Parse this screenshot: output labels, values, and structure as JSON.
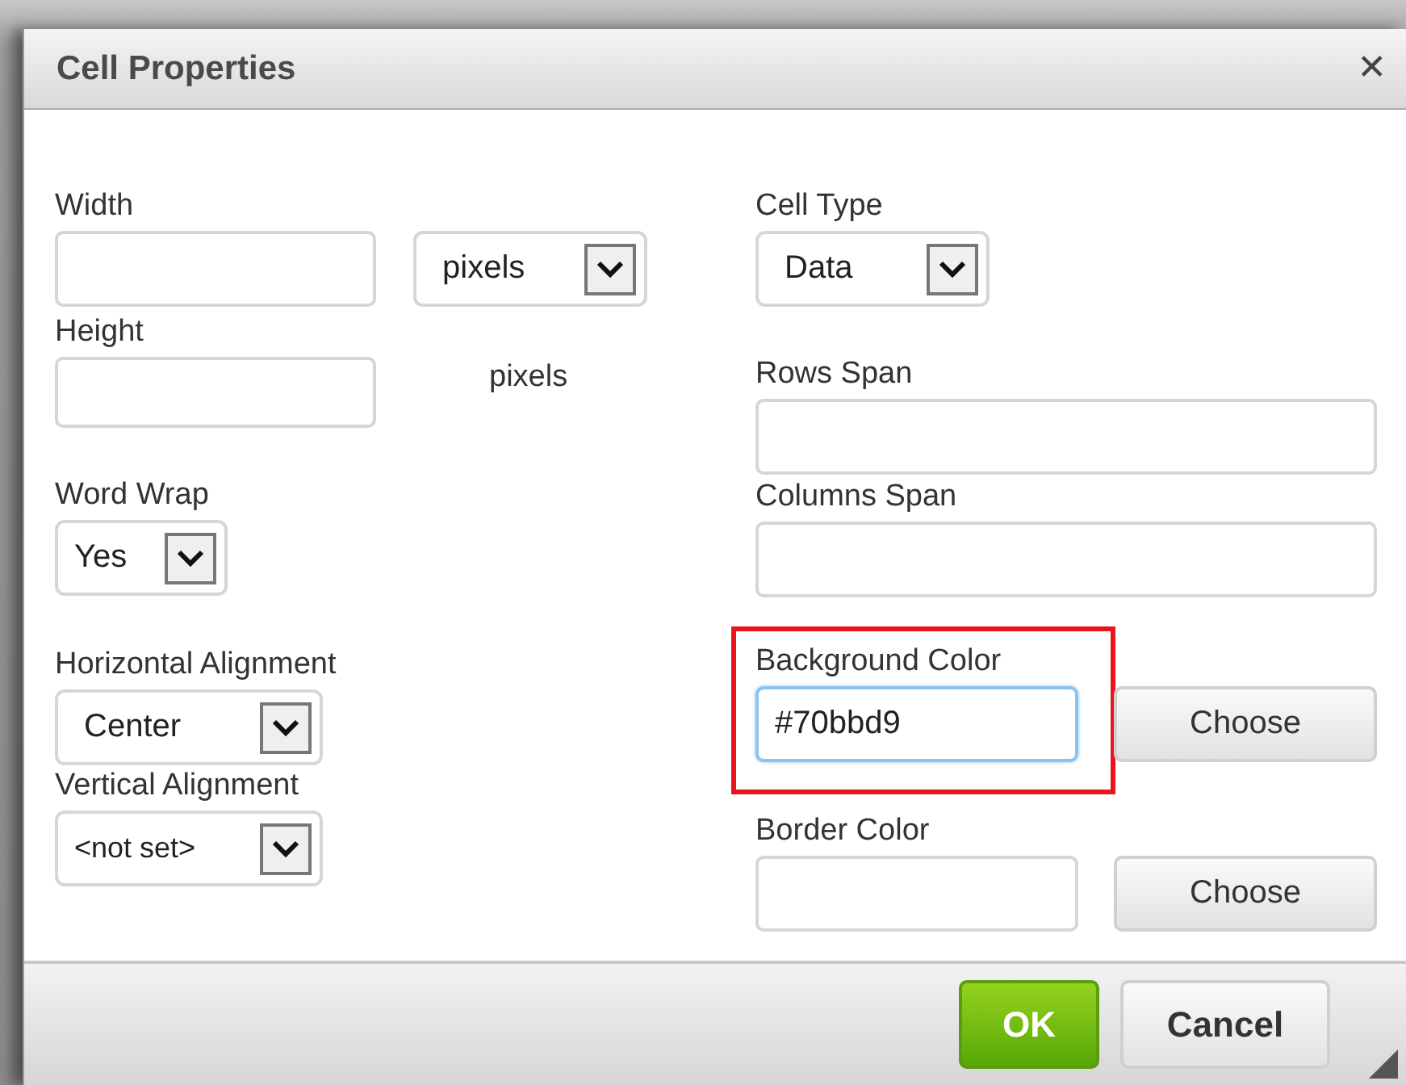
{
  "dialog": {
    "title": "Cell Properties",
    "close": "✕"
  },
  "columns": [
    [
      {
        "label": "Width",
        "controls": [
          {
            "kind": "text",
            "focused": false
          },
          {
            "kind": "select",
            "value": "pixels"
          }
        ]
      },
      {
        "label": "Height",
        "controls": [
          {
            "kind": "text",
            "focused": false
          },
          {
            "kind": "static",
            "value": "pixels"
          }
        ]
      },
      {
        "label": "Word Wrap",
        "controls": [
          {
            "kind": "select",
            "value": "Yes"
          }
        ]
      },
      {
        "label": "Horizontal Alignment",
        "controls": [
          {
            "kind": "select",
            "value": "Center"
          }
        ]
      },
      {
        "label": "Vertical Alignment",
        "controls": [
          {
            "kind": "select",
            "value": "<not set>"
          }
        ]
      }
    ],
    [
      {
        "label": "Cell Type",
        "highlighted": false,
        "controls": [
          {
            "kind": "select",
            "value": "Data"
          }
        ]
      },
      {
        "label": "Rows Span",
        "highlighted": false,
        "controls": [
          {
            "kind": "text",
            "focused": false
          }
        ]
      },
      {
        "label": "Columns Span",
        "highlighted": false,
        "controls": [
          {
            "kind": "text",
            "focused": false
          }
        ]
      },
      {
        "label": "Background Color",
        "highlighted": true,
        "controls": [
          {
            "kind": "text",
            "value": "#70bbd9",
            "focused": true
          },
          {
            "kind": "button",
            "value": "Choose"
          }
        ]
      },
      {
        "label": "Border Color",
        "highlighted": false,
        "controls": [
          {
            "kind": "text",
            "focused": false
          },
          {
            "kind": "button",
            "value": "Choose"
          }
        ]
      }
    ]
  ],
  "buttons": [
    {
      "label": "OK",
      "primary": true
    },
    {
      "label": "Cancel",
      "primary": false
    }
  ]
}
